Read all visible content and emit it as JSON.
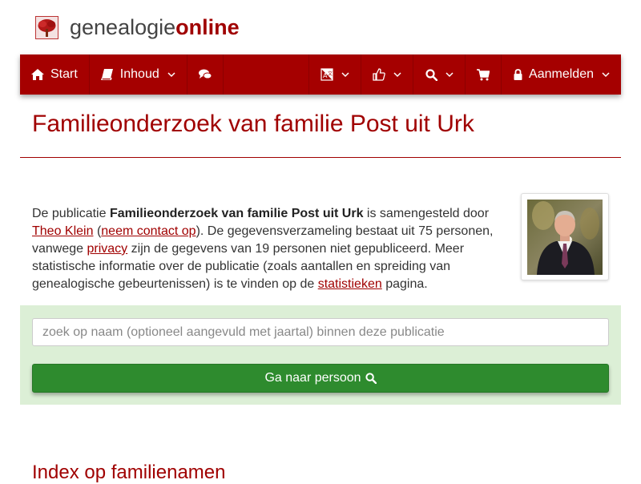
{
  "brand": {
    "name_part1": "genealogie",
    "name_part2": "online",
    "logo_icon": "tree-icon"
  },
  "nav": {
    "start": "Start",
    "inhoud": "Inhoud",
    "aanmelden": "Aanmelden",
    "icons": [
      "home-icon",
      "book-icon",
      "comments-icon",
      "language-icon",
      "thumbs-up-icon",
      "search-icon",
      "cart-icon",
      "lock-icon"
    ]
  },
  "page": {
    "title": "Familieonderzoek van familie Post uit Urk"
  },
  "intro": {
    "t1": "De publicatie ",
    "pub_title": "Familieonderzoek van familie Post uit Urk",
    "t2": " is samengesteld door ",
    "author_link": "Theo Klein",
    "t3": " (",
    "contact_link": "neem contact op",
    "t4": "). De gegevensverzameling bestaat uit 75 personen, vanwege ",
    "privacy_link": "privacy",
    "t5": " zijn de gegevens van 19 personen niet gepubliceerd. Meer statistische informatie over de publicatie (zoals aantallen en spreiding van genealogische gebeurtenissen) is te vinden op de ",
    "stats_link": "statistieken",
    "t6": " pagina."
  },
  "search": {
    "placeholder": "zoek op naam (optioneel aangevuld met jaartal) binnen deze publicatie",
    "value": "",
    "button_label": "Ga naar persoon"
  },
  "index": {
    "heading": "Index op familienamen"
  },
  "colors": {
    "brand_red": "#a50000",
    "search_panel_bg": "#dcefd6",
    "button_green": "#2e8b2e"
  }
}
